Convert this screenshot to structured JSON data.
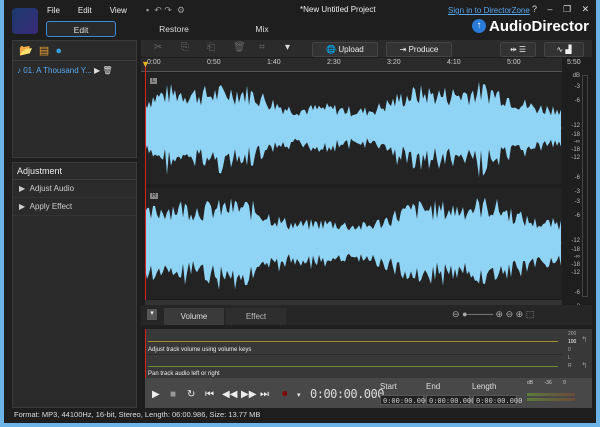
{
  "title": "*New Untitled Project",
  "menu": [
    "File",
    "Edit",
    "View"
  ],
  "sign_in": "Sign in to DirectorZone",
  "window_controls": [
    "?",
    "–",
    "❐",
    "✕"
  ],
  "modes": {
    "edit": "Edit",
    "restore": "Restore",
    "mix": "Mix"
  },
  "brand": "AudioDirector",
  "media": {
    "items": [
      {
        "name": "01. A Thousand Y..."
      }
    ]
  },
  "adjustment": {
    "title": "Adjustment",
    "items": [
      "Adjust Audio",
      "Apply Effect"
    ]
  },
  "toolbar": {
    "upload": "Upload",
    "produce": "Produce"
  },
  "ruler": [
    "0:00",
    "0:50",
    "1:40",
    "2:30",
    "3:20",
    "4:10",
    "5:00",
    "5:50"
  ],
  "tracks": [
    {
      "label": "L"
    },
    {
      "label": "R"
    }
  ],
  "db_scale": {
    "top": "dB",
    "labels": [
      "-3",
      "-6",
      "-12",
      "-18",
      "-∞",
      "-18",
      "-12",
      "-6",
      "-3"
    ]
  },
  "colors": {
    "wave": "#8fd3f5",
    "playhead": "#e02020",
    "volume_line": "#a09030",
    "pan_line": "#6a8a30",
    "accent": "#3a8ad8"
  },
  "bottom_tabs": {
    "volume": "Volume",
    "effect": "Effect"
  },
  "lanes": {
    "volume_hint": "Adjust track volume using volume keys",
    "pan_hint": "Pan track audio left or right",
    "volume_scale": [
      "200",
      "100",
      "0"
    ],
    "pan_scale": [
      "L",
      "R"
    ]
  },
  "transport": {
    "timecode": "0:00:00.000",
    "start_label": "Start",
    "end_label": "End",
    "length_label": "Length",
    "start": "0:00:00.000",
    "end": "0:00:00.000",
    "length": "0:00:00.000",
    "meter_labels": [
      "dB",
      "-36",
      "0"
    ]
  },
  "status": "Format: MP3, 44100Hz, 16-bit, Stereo, Length: 06:00.986, Size: 13.77 MB"
}
